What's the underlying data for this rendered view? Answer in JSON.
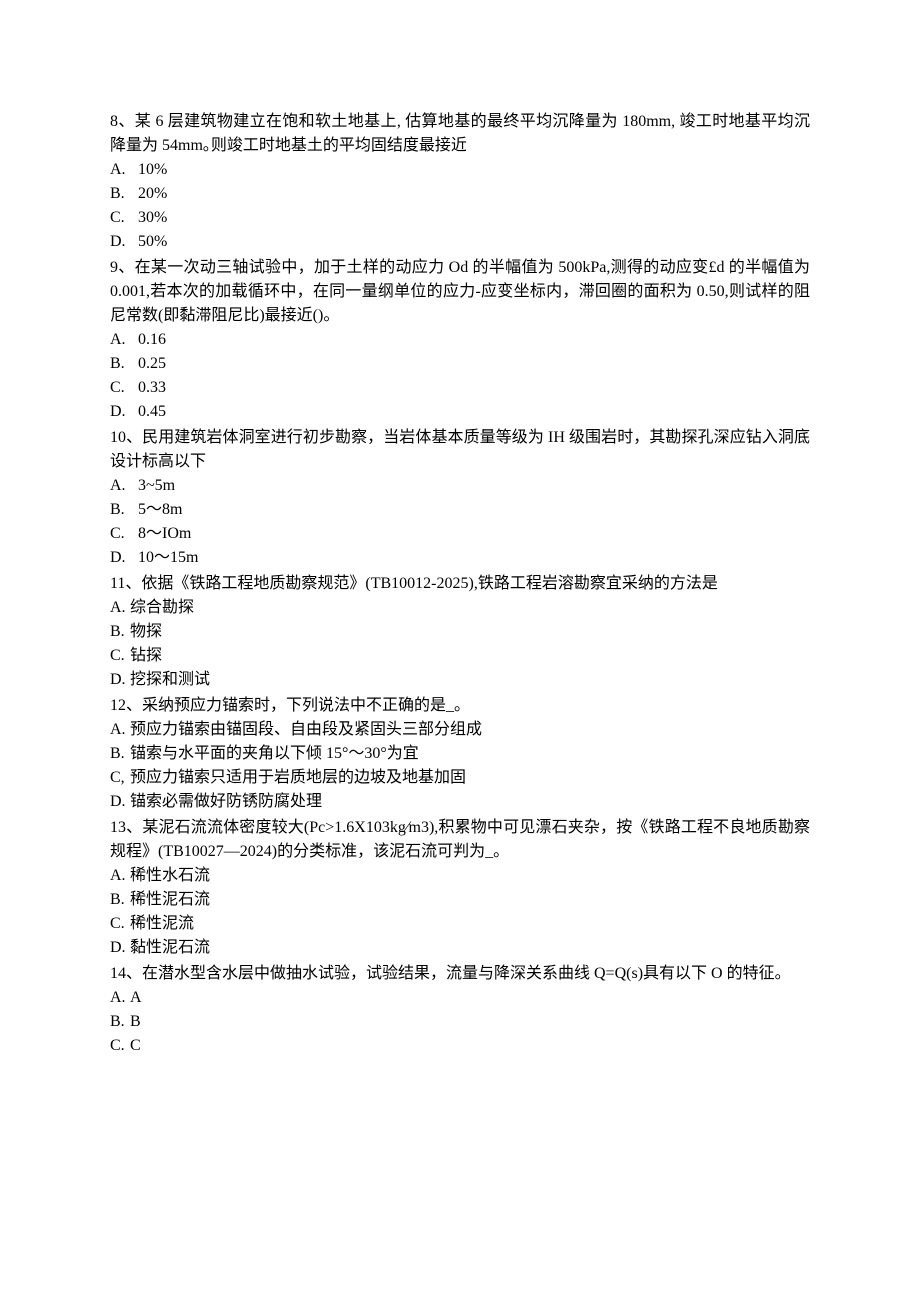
{
  "questions": [
    {
      "num": "8",
      "text": "某 6 层建筑物建立在饱和软土地基上, 估算地基的最终平均沉降量为 180mm, 竣工时地基平均沉降量为 54mm｡则竣工时地基土的平均固结度最接近",
      "choices": [
        {
          "label": "A.",
          "text": "10%"
        },
        {
          "label": "B.",
          "text": "20%"
        },
        {
          "label": "C.",
          "text": "30%"
        },
        {
          "label": "D.",
          "text": "50%"
        }
      ]
    },
    {
      "num": "9",
      "text": "在某一次动三轴试验中，加于土样的动应力 Od 的半幅值为 500kPa,测得的动应变£d 的半幅值为 0.001,若本次的加载循环中，在同一量纲单位的应力-应变坐标内，滞回圈的面积为 0.50,则试样的阻尼常数(即黏滞阻尼比)最接近()。",
      "choices": [
        {
          "label": "A.",
          "text": "0.16"
        },
        {
          "label": "B.",
          "text": "0.25"
        },
        {
          "label": "C.",
          "text": "0.33"
        },
        {
          "label": "D.",
          "text": "0.45"
        }
      ]
    },
    {
      "num": "10",
      "text": "民用建筑岩体洞室进行初步勘察，当岩体基本质量等级为 IH 级围岩时，其勘探孔深应钻入洞底设计标高以下",
      "choices": [
        {
          "label": "A.",
          "text": "3~5m"
        },
        {
          "label": "B.",
          "text": "5～8m"
        },
        {
          "label": "C.",
          "text": "8～IOm"
        },
        {
          "label": "D.",
          "text": "10～15m"
        }
      ]
    },
    {
      "num": "11",
      "text": "依据《铁路工程地质勘察规范》(TB10012-2025),铁路工程岩溶勘察宜采纳的方法是",
      "choices": [
        {
          "label": "A.",
          "text": "综合勘探"
        },
        {
          "label": "B.",
          "text": "物探"
        },
        {
          "label": "C.",
          "text": "钻探"
        },
        {
          "label": "D.",
          "text": "挖探和测试"
        }
      ]
    },
    {
      "num": "12",
      "text": "采纳预应力锚索时，下列说法中不正确的是_。",
      "choices": [
        {
          "label": "A.",
          "text": "预应力锚索由锚固段、自由段及紧固头三部分组成"
        },
        {
          "label": "B.",
          "text": "锚索与水平面的夹角以下倾 15°～30°为宜"
        },
        {
          "label": "C,",
          "text": "预应力锚索只适用于岩质地层的边坡及地基加固"
        },
        {
          "label": "D.",
          "text": "锚索必需做好防锈防腐处理"
        }
      ]
    },
    {
      "num": "13",
      "text": "某泥石流流体密度较大(Pc>1.6X103kg⁄m3),积累物中可见漂石夹杂，按《铁路工程不良地质勘察规程》(TB10027—2024)的分类标准，该泥石流可判为_。",
      "choices": [
        {
          "label": "A.",
          "text": "稀性水石流"
        },
        {
          "label": "B.",
          "text": "稀性泥石流"
        },
        {
          "label": "C.",
          "text": "稀性泥流"
        },
        {
          "label": "D.",
          "text": "黏性泥石流"
        }
      ]
    },
    {
      "num": "14",
      "text": "在潜水型含水层中做抽水试验，试验结果，流量与降深关系曲线 Q=Q(s)具有以下 O 的特征。",
      "choices": [
        {
          "label": "A.",
          "text": "A"
        },
        {
          "label": "B.",
          "text": "B"
        },
        {
          "label": "C.",
          "text": "C"
        }
      ]
    }
  ],
  "indentedChoiceQuestions": [
    "8",
    "9",
    "10"
  ]
}
